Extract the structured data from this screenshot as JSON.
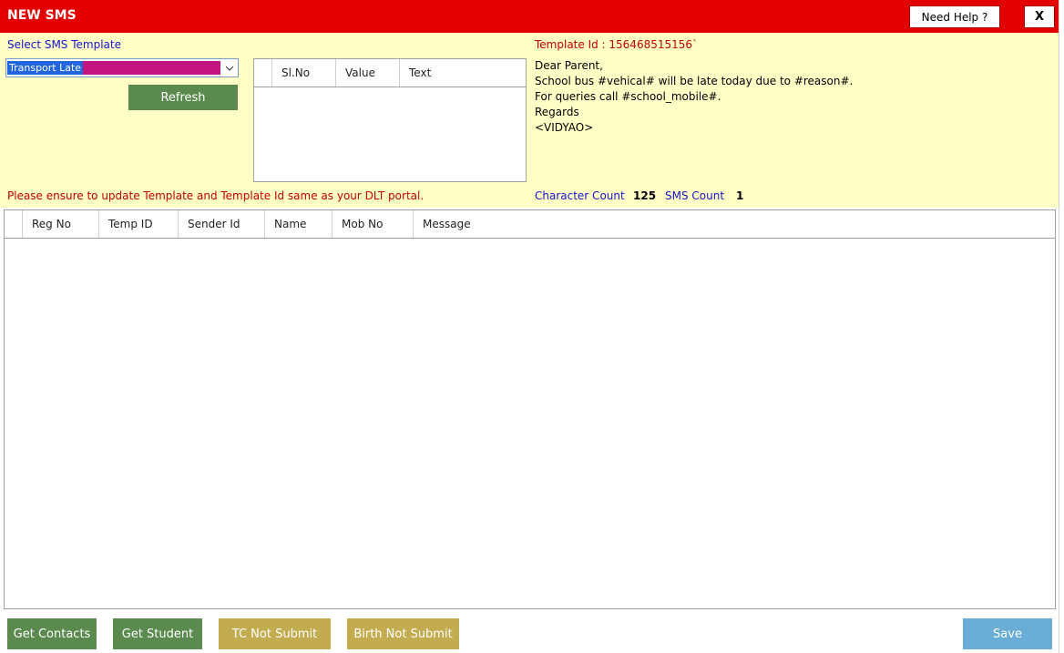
{
  "window": {
    "title": "NEW SMS",
    "help_label": "Need Help ?",
    "close_label": "X"
  },
  "template_panel": {
    "select_label": "Select SMS Template",
    "selected_template": "Transport Late",
    "refresh_label": "Refresh",
    "warning": "Please ensure to update Template and Template Id same as your DLT portal."
  },
  "param_grid": {
    "columns": [
      "Sl.No",
      "Value",
      "Text"
    ]
  },
  "message": {
    "template_id_label": "Template Id : 156468515156`",
    "lines": [
      "Dear Parent,",
      "School bus #vehical# will be late today due to #reason#.",
      "For queries call #school_mobile#.",
      "Regards",
      "<VIDYAO>"
    ],
    "character_count_label": "Character Count",
    "character_count": "125",
    "sms_count_label": "SMS Count",
    "sms_count": "1"
  },
  "main_grid": {
    "columns": [
      "Reg No",
      "Temp ID",
      "Sender Id",
      "Name",
      "Mob No",
      "Message"
    ]
  },
  "actions": {
    "get_contacts": "Get Contacts",
    "get_student": "Get Student",
    "tc_not_submit": "TC Not Submit",
    "birth_not_submit": "Birth Not Submit",
    "save": "Save"
  },
  "colors": {
    "title_bar": "#e30000",
    "panel_bg": "#ffffc6",
    "green_button": "#5a8a4e",
    "olive_button": "#c2ac4f",
    "save_button": "#6aaed8"
  }
}
